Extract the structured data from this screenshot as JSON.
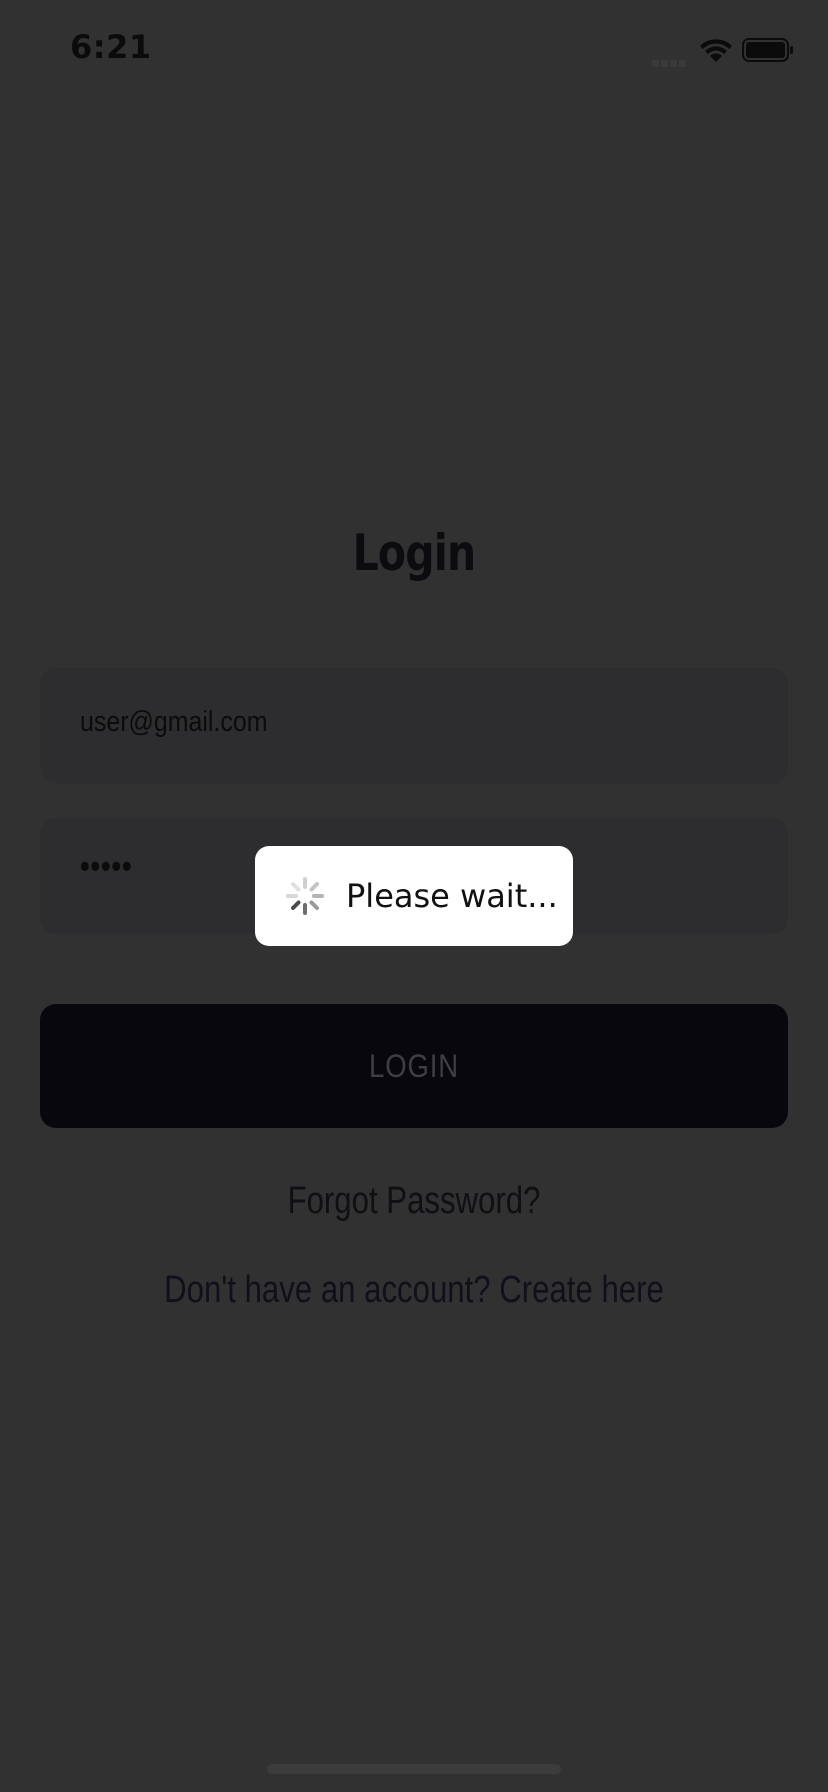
{
  "status_bar": {
    "time": "6:21",
    "icons": [
      "signal-icon",
      "wifi-icon",
      "battery-icon"
    ]
  },
  "login": {
    "title": "Login",
    "email_value": "user@gmail.com",
    "password_value": "•••••",
    "button_label": "LOGIN",
    "forgot_link": "Forgot Password?",
    "create_link": "Don't have an account? Create here"
  },
  "hud": {
    "message": "Please wait...",
    "icon": "spinner-icon"
  },
  "colors": {
    "background": "#313131",
    "field_bg": "#2d2d2f",
    "button_bg": "#08070d",
    "hud_bg": "#ffffff"
  }
}
